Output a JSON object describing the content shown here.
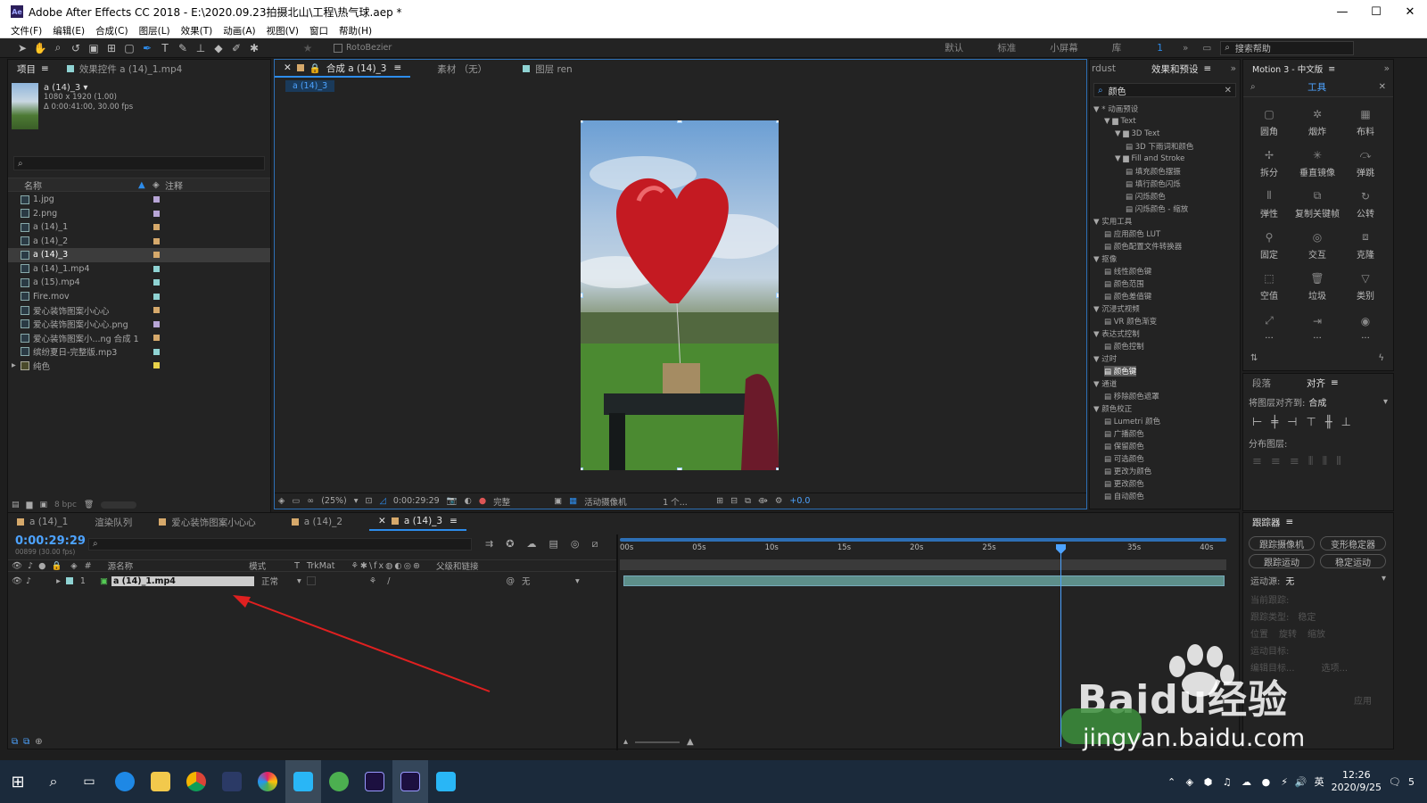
{
  "window": {
    "title": "Adobe After Effects CC 2018 - E:\\2020.09.23拍摄北山\\工程\\热气球.aep *",
    "logo": "Ae",
    "min": "—",
    "max": "☐",
    "close": "✕"
  },
  "menu": [
    "文件(F)",
    "编辑(E)",
    "合成(C)",
    "图层(L)",
    "效果(T)",
    "动画(A)",
    "视图(V)",
    "窗口",
    "帮助(H)"
  ],
  "toolbar": {
    "rotobezier": "RotoBezier",
    "workspaces": [
      "默认",
      "标准",
      "小屏幕",
      "库"
    ],
    "ws_count": "1",
    "search_help": "搜索帮助"
  },
  "project": {
    "tab_project": "项目",
    "tab_effects": "效果控件 a (14)_1.mp4",
    "thumb": {
      "name": "a (14)_3",
      "dims": "1080 x 1920 (1.00)",
      "duration": "Δ 0:00:41:00, 30.00 fps"
    },
    "col_name": "名称",
    "col_comment": "注释",
    "items": [
      {
        "name": "1.jpg",
        "color": "#b7a5d6"
      },
      {
        "name": "2.png",
        "color": "#b7a5d6"
      },
      {
        "name": "a (14)_1",
        "color": "#d6a96b"
      },
      {
        "name": "a (14)_2",
        "color": "#d6a96b"
      },
      {
        "name": "a (14)_3",
        "color": "#d6a96b"
      },
      {
        "name": "a (14)_1.mp4",
        "color": "#8fd3d3"
      },
      {
        "name": "a (15).mp4",
        "color": "#8fd3d3"
      },
      {
        "name": "Fire.mov",
        "color": "#8fd3d3"
      },
      {
        "name": "爱心装饰图案小心心",
        "color": "#d6a96b"
      },
      {
        "name": "爱心装饰图案小心心.png",
        "color": "#b7a5d6"
      },
      {
        "name": "爱心装饰图案小...ng 合成 1",
        "color": "#d6a96b"
      },
      {
        "name": "缤纷夏日-完整版.mp3",
        "color": "#8fd3d3"
      },
      {
        "name": "纯色",
        "color": "#e8d24a"
      }
    ],
    "bpc": "8 bpc"
  },
  "viewer": {
    "tabs": [
      "合成 a (14)_3",
      "素材 （无）",
      "图层 ren"
    ],
    "breadcrumb": "a (14)_3",
    "zoom": "(25%)",
    "time": "0:00:29:29",
    "quality": "完整",
    "camera": "活动摄像机",
    "views": "1 个...",
    "exposure": "+0.0"
  },
  "effects": {
    "tab_left": "rdust",
    "tab": "效果和预设",
    "search": "颜色",
    "tree": [
      {
        "d": 0,
        "t": "▼ * 动画预设"
      },
      {
        "d": 1,
        "t": "▼ ▆ Text"
      },
      {
        "d": 2,
        "t": "▼ ▆ 3D Text"
      },
      {
        "d": 3,
        "t": "▤ 3D 下雨词和颜色"
      },
      {
        "d": 2,
        "t": "▼ ▆ Fill and Stroke"
      },
      {
        "d": 3,
        "t": "▤ 填充颜色摆振"
      },
      {
        "d": 3,
        "t": "▤ 填行颜色闪烁"
      },
      {
        "d": 3,
        "t": "▤ 闪烁颜色"
      },
      {
        "d": 3,
        "t": "▤ 闪烁颜色 - 缩放"
      },
      {
        "d": 0,
        "t": "▼ 实用工具"
      },
      {
        "d": 1,
        "t": "▤ 应用颜色 LUT"
      },
      {
        "d": 1,
        "t": "▤ 颜色配置文件转换器"
      },
      {
        "d": 0,
        "t": "▼ 抠像"
      },
      {
        "d": 1,
        "t": "▤ 线性颜色键"
      },
      {
        "d": 1,
        "t": "▤ 颜色范围"
      },
      {
        "d": 1,
        "t": "▤ 颜色差值键"
      },
      {
        "d": 0,
        "t": "▼ 沉浸式视频"
      },
      {
        "d": 1,
        "t": "▤ VR 颜色渐变"
      },
      {
        "d": 0,
        "t": "▼ 表达式控制"
      },
      {
        "d": 1,
        "t": "▤ 颜色控制"
      },
      {
        "d": 0,
        "t": "▼ 过时"
      },
      {
        "d": 1,
        "t": "▤ 颜色键",
        "sel": true
      },
      {
        "d": 0,
        "t": "▼ 通道"
      },
      {
        "d": 1,
        "t": "▤ 移除颜色遮罩"
      },
      {
        "d": 0,
        "t": "▼ 颜色校正"
      },
      {
        "d": 1,
        "t": "▤ Lumetri 颜色"
      },
      {
        "d": 1,
        "t": "▤ 广播颜色"
      },
      {
        "d": 1,
        "t": "▤ 保留颜色"
      },
      {
        "d": 1,
        "t": "▤ 可选颜色"
      },
      {
        "d": 1,
        "t": "▤ 更改为颜色"
      },
      {
        "d": 1,
        "t": "▤ 更改颜色"
      },
      {
        "d": 1,
        "t": "▤ 自动颜色"
      }
    ]
  },
  "motion": {
    "tab": "Motion 3 - 中文版",
    "tools_label": "工具",
    "tools": [
      {
        "g": "▢",
        "t": "圆角"
      },
      {
        "g": "✲",
        "t": "烟炸"
      },
      {
        "g": "▦",
        "t": "布料"
      },
      {
        "g": "✢",
        "t": "拆分"
      },
      {
        "g": "✳",
        "t": "垂直镜像"
      },
      {
        "g": "⤼",
        "t": "弹跳"
      },
      {
        "g": "⦀",
        "t": "弹性"
      },
      {
        "g": "⧉",
        "t": "复制关键帧"
      },
      {
        "g": "↻",
        "t": "公转"
      },
      {
        "g": "⚲",
        "t": "固定"
      },
      {
        "g": "◎",
        "t": "交互"
      },
      {
        "g": "⧈",
        "t": "克隆"
      },
      {
        "g": "⬚",
        "t": "空值"
      },
      {
        "g": "🗑",
        "t": "垃圾"
      },
      {
        "g": "▽",
        "t": "类别"
      },
      {
        "g": "⤢",
        "t": "..."
      },
      {
        "g": "⇥",
        "t": "..."
      },
      {
        "g": "◉",
        "t": "..."
      }
    ]
  },
  "align": {
    "tab_para": "段落",
    "tab_align": "对齐",
    "align_to_label": "将图层对齐到:",
    "align_to": "合成",
    "distribute": "分布图层:"
  },
  "timeline": {
    "tabs": [
      "a (14)_1",
      "渲染队列",
      "爱心装饰图案小心心",
      "a (14)_2",
      "a (14)_3"
    ],
    "timecode": "0:00:29:29",
    "frames": "00899 (30.00 fps)",
    "cols": {
      "src": "源名称",
      "mode": "模式",
      "t": "T",
      "trkmat": "TrkMat",
      "parent": "父级和链接"
    },
    "layer": {
      "num": "1",
      "name": "a (14)_1.mp4",
      "mode": "正常",
      "parent": "无"
    },
    "ruler": [
      "00s",
      "05s",
      "10s",
      "15s",
      "20s",
      "25s",
      "",
      "35s",
      "40s"
    ]
  },
  "tracker": {
    "tab": "跟踪器",
    "btn_camera": "跟踪摄像机",
    "btn_stab": "变形稳定器",
    "btn_track": "跟踪运动",
    "btn_stabilize": "稳定运动",
    "source_label": "运动源:",
    "source": "无",
    "current_track": "当前跟踪:",
    "track_type": "跟踪类型:",
    "track_type_val": "稳定",
    "pos": "位置",
    "rot": "旋转",
    "scale": "缩放",
    "target": "运动目标:",
    "edit_target": "编辑目标...",
    "options": "选项...",
    "apply": "应用"
  },
  "taskbar": {
    "time": "12:26",
    "date": "2020/9/25",
    "ime": "英",
    "notif": "5"
  },
  "watermark": {
    "brand": "Baidu经验",
    "url": "jingyan.baidu.com"
  },
  "colors": {
    "accent": "#2d8ceb",
    "timecode": "#4da3ff"
  }
}
